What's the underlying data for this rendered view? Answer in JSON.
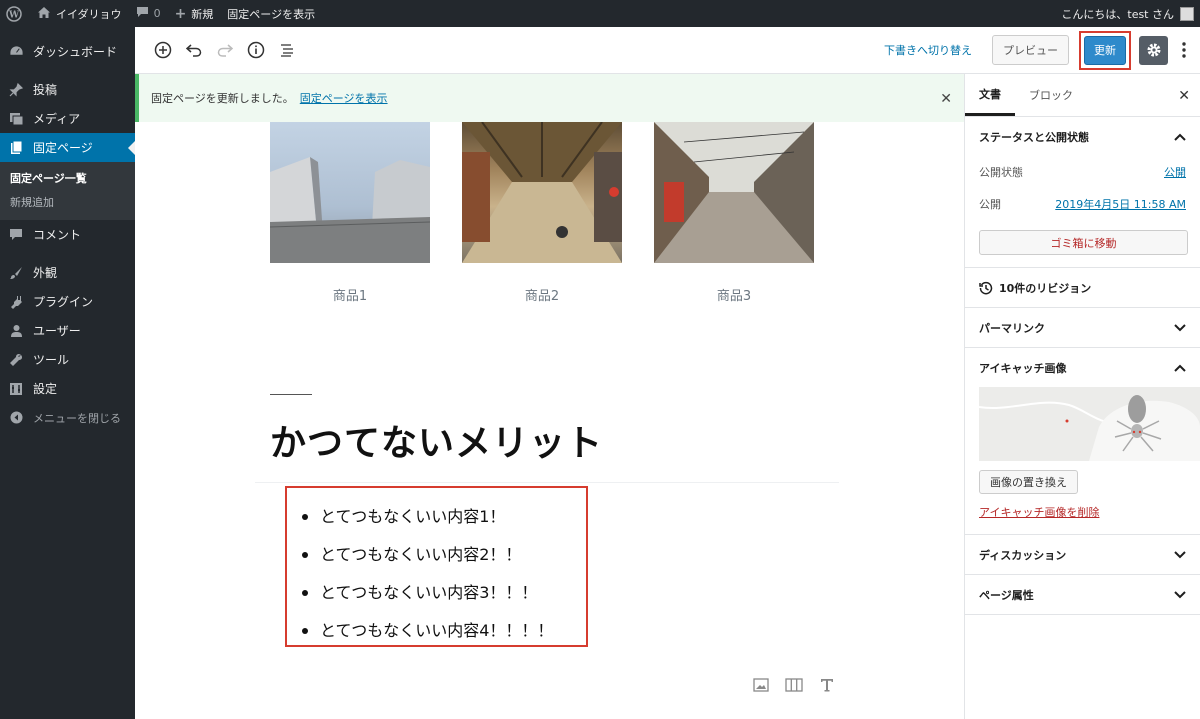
{
  "admin_bar": {
    "site_name": "イイダリョウ",
    "comments_count": "0",
    "new_label": "新規",
    "view_page_label": "固定ページを表示",
    "greeting": "こんにちは、test さん"
  },
  "sidebar": {
    "items": [
      {
        "label": "ダッシュボード",
        "icon": "dashboard-icon"
      },
      {
        "label": "投稿",
        "icon": "pin-icon"
      },
      {
        "label": "メディア",
        "icon": "media-icon"
      },
      {
        "label": "固定ページ",
        "icon": "page-icon"
      },
      {
        "label": "コメント",
        "icon": "comment-icon"
      },
      {
        "label": "外観",
        "icon": "brush-icon"
      },
      {
        "label": "プラグイン",
        "icon": "plugin-icon"
      },
      {
        "label": "ユーザー",
        "icon": "user-icon"
      },
      {
        "label": "ツール",
        "icon": "wrench-icon"
      },
      {
        "label": "設定",
        "icon": "settings-icon"
      }
    ],
    "submenu": [
      "固定ページ一覧",
      "新規追加"
    ],
    "collapse_label": "メニューを閉じる"
  },
  "toolbar": {
    "switch_draft": "下書きへ切り替え",
    "preview": "プレビュー",
    "update": "更新"
  },
  "notice": {
    "message": "固定ページを更新しました。",
    "link": "固定ページを表示"
  },
  "content": {
    "gallery": [
      {
        "caption": "商品1"
      },
      {
        "caption": "商品2"
      },
      {
        "caption": "商品3"
      }
    ],
    "heading": "かつてないメリット",
    "list": [
      "とてつもなくいい内容1！",
      "とてつもなくいい内容2！！",
      "とてつもなくいい内容3！！！",
      "とてつもなくいい内容4！！！！"
    ]
  },
  "panel": {
    "tabs": [
      "文書",
      "ブロック"
    ],
    "status_title": "ステータスと公開状態",
    "visibility_label": "公開状態",
    "visibility_value": "公開",
    "publish_label": "公開",
    "publish_value": "2019年4月5日 11:58 AM",
    "trash": "ゴミ箱に移動",
    "revisions": "10件のリビジョン",
    "permalink": "パーマリンク",
    "featured_title": "アイキャッチ画像",
    "replace_image": "画像の置き換え",
    "remove_image": "アイキャッチ画像を削除",
    "discussion": "ディスカッション",
    "page_attributes": "ページ属性"
  }
}
